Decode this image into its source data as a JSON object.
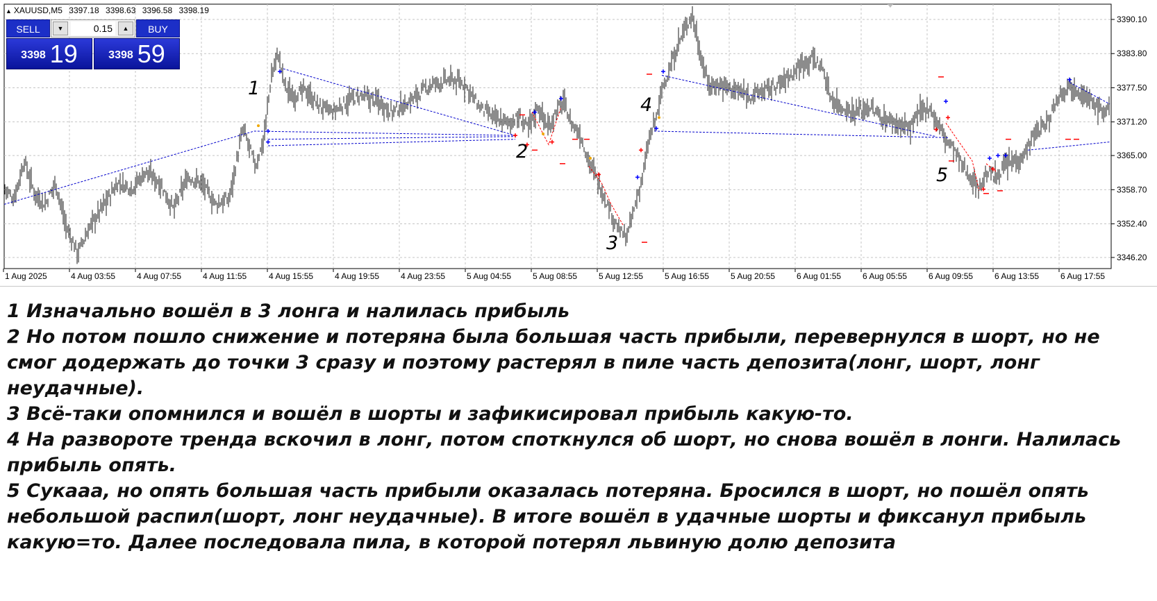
{
  "chart": {
    "symbol": "XAUUSD,M5",
    "ohlc": [
      "3397.18",
      "3398.63",
      "3396.58",
      "3398.19"
    ],
    "price_labels": [
      "3390.10",
      "3383.80",
      "3377.50",
      "3371.20",
      "3365.00",
      "3358.70",
      "3352.40",
      "3346.20"
    ],
    "time_labels": [
      "1 Aug 2025",
      "4 Aug 03:55",
      "4 Aug 07:55",
      "4 Aug 11:55",
      "4 Aug 15:55",
      "4 Aug 19:55",
      "4 Aug 23:55",
      "5 Aug 04:55",
      "5 Aug 08:55",
      "5 Aug 12:55",
      "5 Aug 16:55",
      "5 Aug 20:55",
      "6 Aug 01:55",
      "6 Aug 05:55",
      "6 Aug 09:55",
      "6 Aug 13:55",
      "6 Aug 17:55"
    ],
    "colors": {
      "bars": "#1a1a1a",
      "grid": "#c4c4c4",
      "trend_line": "#0000cc",
      "buy_marker": "#0000ff",
      "sell_marker": "#ff0000",
      "close_buy": "#f0a800"
    }
  },
  "trade_panel": {
    "sell_label": "SELL",
    "buy_label": "BUY",
    "lot_value": "0.15",
    "sell_price_small": "3398",
    "sell_price_big": "19",
    "buy_price_small": "3398",
    "buy_price_big": "59"
  },
  "wave_labels": [
    "1",
    "2",
    "3",
    "4",
    "5"
  ],
  "notes": [
    "1 Изначально вошёл в 3 лонга и налилась прибыль",
    "2 Но потом пошло снижение и потеряна была большая часть прибыли, перевернулся в шорт, но не смог додержать до точки 3 сразу и поэтому растерял в пиле часть депозита(лонг, шорт, лонг неудачные).",
    "3 Всё-таки опомнился и вошёл в шорты и зафикисировал прибыль какую-то.",
    "4 На развороте тренда вскочил в лонг, потом споткнулся об шорт, но снова вошёл в лонги. Налилась прибыль опять.",
    "5 Сукааа, но опять большая часть прибыли оказалась потеряна. Бросился в шорт, но пошёл опять небольшой распил(шорт, лонг неудачные). В итоге вошёл в удачные шорты и фиксанул прибыль какую=то. Далее последовала пила, в которой потерял львиную долю депозита"
  ]
}
